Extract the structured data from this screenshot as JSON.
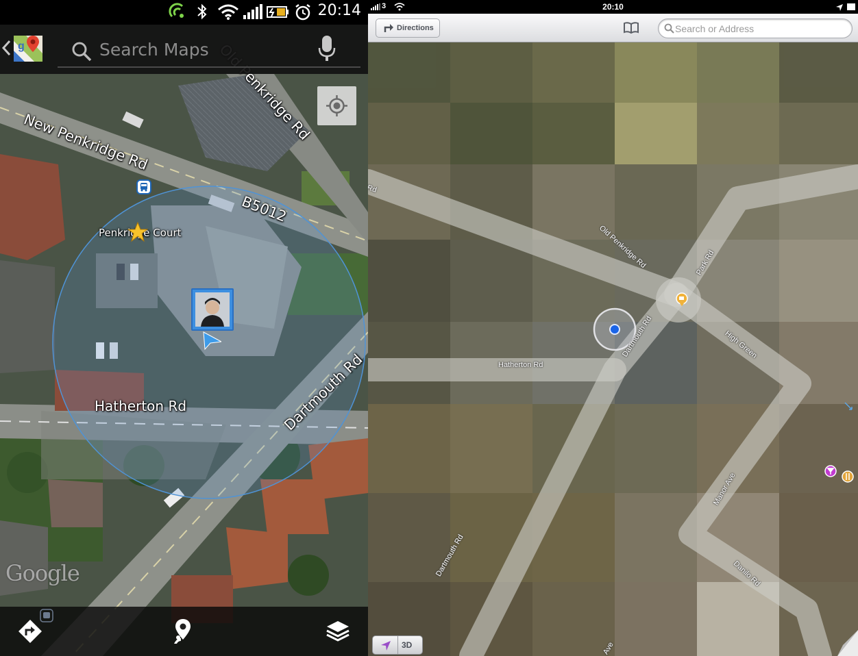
{
  "android": {
    "status_bar": {
      "time": "20:14"
    },
    "search": {
      "placeholder": "Search Maps"
    },
    "map": {
      "labels": {
        "new_penkridge_rd": "New Penkridge Rd",
        "old_penkridge_rd": "Old Penkridge Rd",
        "b5012": "B5012",
        "penkridge_court": "Penkridge Court",
        "hatherton_rd": "Hatherton Rd",
        "dartmouth_rd": "Dartmouth Rd"
      },
      "watermark": "Google"
    },
    "icons": [
      "back-chevron-icon",
      "google-maps-logo-icon",
      "search-icon",
      "microphone-icon",
      "my-location-icon",
      "directions-icon",
      "places-icon",
      "layers-icon",
      "bus-stop-icon",
      "star-icon"
    ]
  },
  "ios": {
    "status_bar": {
      "carrier": "3",
      "time": "20:10"
    },
    "toolbar": {
      "directions_label": "Directions",
      "search_placeholder": "Search or Address"
    },
    "map": {
      "labels": {
        "rd_partial": "Rd",
        "old_penkridge_rd": "Old Penkridge Rd",
        "park_rd": "Park Rd",
        "dartmouth_rd": "Dartmouth Rd",
        "high_green": "High Green",
        "hatherton_rd": "Hatherton Rd",
        "manor_ave": "Manor Ave",
        "dartmouth_rd_2": "Dartmouth Rd",
        "danilo_rd": "Danilo Rd",
        "ave_partial": "Ave"
      }
    },
    "bottom_toolbar": {
      "three_d_label": "3D"
    }
  }
}
